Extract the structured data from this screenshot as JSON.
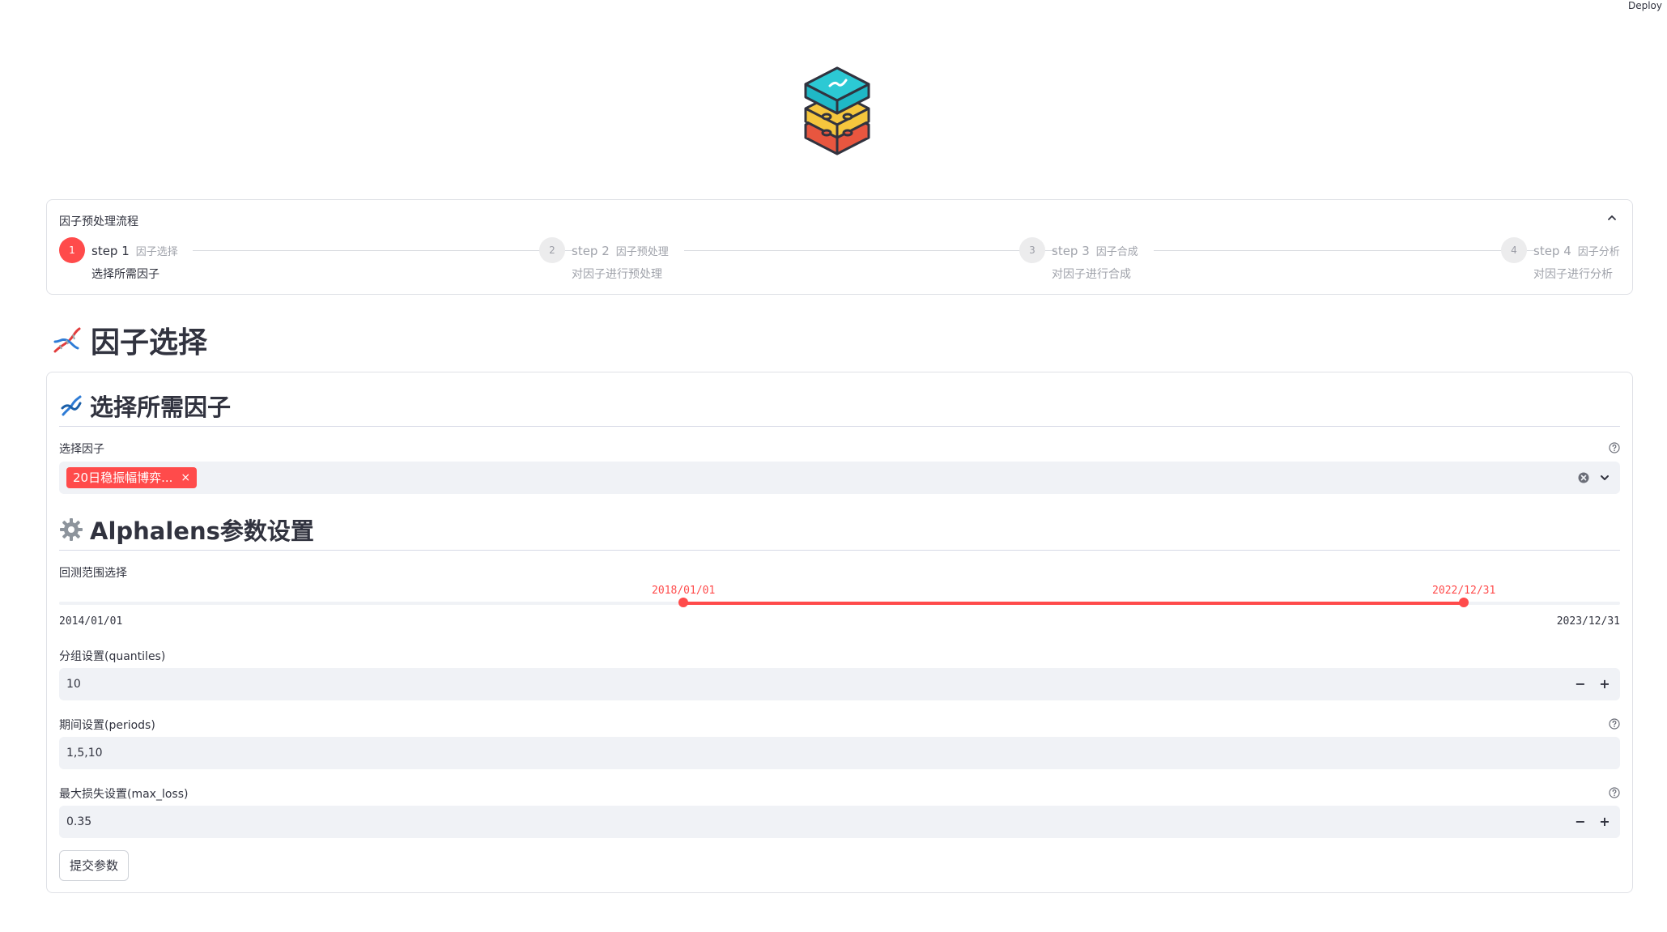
{
  "header": {
    "deploy_label": "Deploy"
  },
  "steps_panel": {
    "title": "因子预处理流程",
    "steps": [
      {
        "number": "1",
        "label": "step 1",
        "sublabel": "因子选择",
        "desc": "选择所需因子",
        "active": true
      },
      {
        "number": "2",
        "label": "step 2",
        "sublabel": "因子预处理",
        "desc": "对因子进行预处理",
        "active": false
      },
      {
        "number": "3",
        "label": "step 3",
        "sublabel": "因子合成",
        "desc": "对因子进行合成",
        "active": false
      },
      {
        "number": "4",
        "label": "step 4",
        "sublabel": "因子分析",
        "desc": "对因子进行分析",
        "active": false
      }
    ]
  },
  "page": {
    "heading": "因子选择",
    "heading_icon": "dna-icon"
  },
  "factor_section": {
    "heading": "选择所需因子",
    "heading_icon": "dna-icon",
    "select_label": "选择因子",
    "selected_tags": [
      "20日稳振幅博弈..."
    ],
    "tag_remove": "×"
  },
  "params_section": {
    "heading": "Alphalens参数设置",
    "heading_icon": "gear-icon",
    "range": {
      "label": "回测范围选择",
      "min": "2014/01/01",
      "max": "2023/12/31",
      "start": "2018/01/01",
      "end": "2022/12/31",
      "start_fraction": 0.4,
      "end_fraction": 0.9
    },
    "quantiles": {
      "label": "分组设置(quantiles)",
      "value": "10",
      "minus": "−",
      "plus": "+"
    },
    "periods": {
      "label": "期间设置(periods)",
      "value": "1,5,10"
    },
    "max_loss": {
      "label": "最大损失设置(max_loss)",
      "value": "0.35",
      "minus": "−",
      "plus": "+"
    },
    "submit_label": "提交参数"
  },
  "colors": {
    "accent": "#ff4b4b",
    "input_bg": "#f0f2f6",
    "text": "#31333f",
    "muted": "#a0a3ab"
  }
}
